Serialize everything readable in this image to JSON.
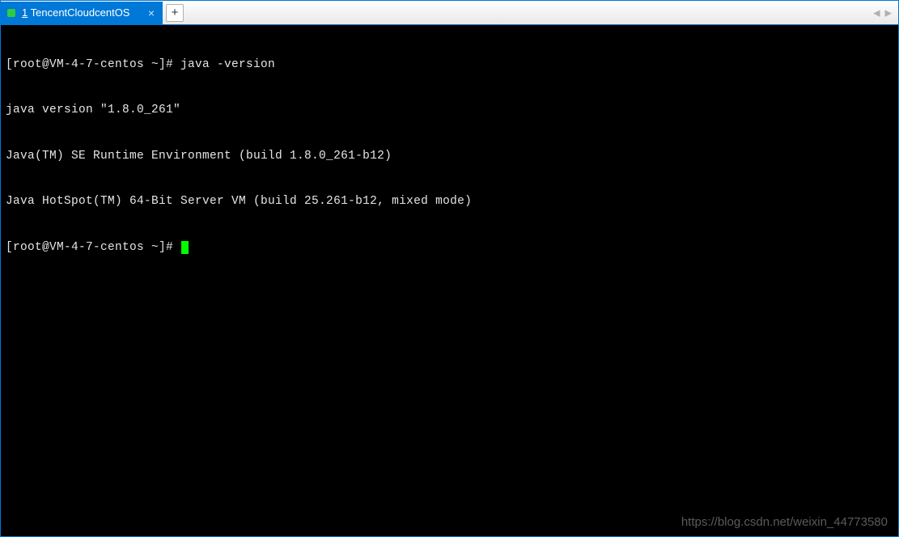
{
  "tabs": {
    "active": {
      "index_label": "1",
      "title": "TencentCloudcentOS"
    },
    "add_label": "+"
  },
  "nav": {
    "left": "◀",
    "right": "▶"
  },
  "terminal": {
    "lines": [
      "[root@VM-4-7-centos ~]# java -version",
      "java version \"1.8.0_261\"",
      "Java(TM) SE Runtime Environment (build 1.8.0_261-b12)",
      "Java HotSpot(TM) 64-Bit Server VM (build 25.261-b12, mixed mode)"
    ],
    "prompt": "[root@VM-4-7-centos ~]# "
  },
  "watermark": "https://blog.csdn.net/weixin_44773580"
}
